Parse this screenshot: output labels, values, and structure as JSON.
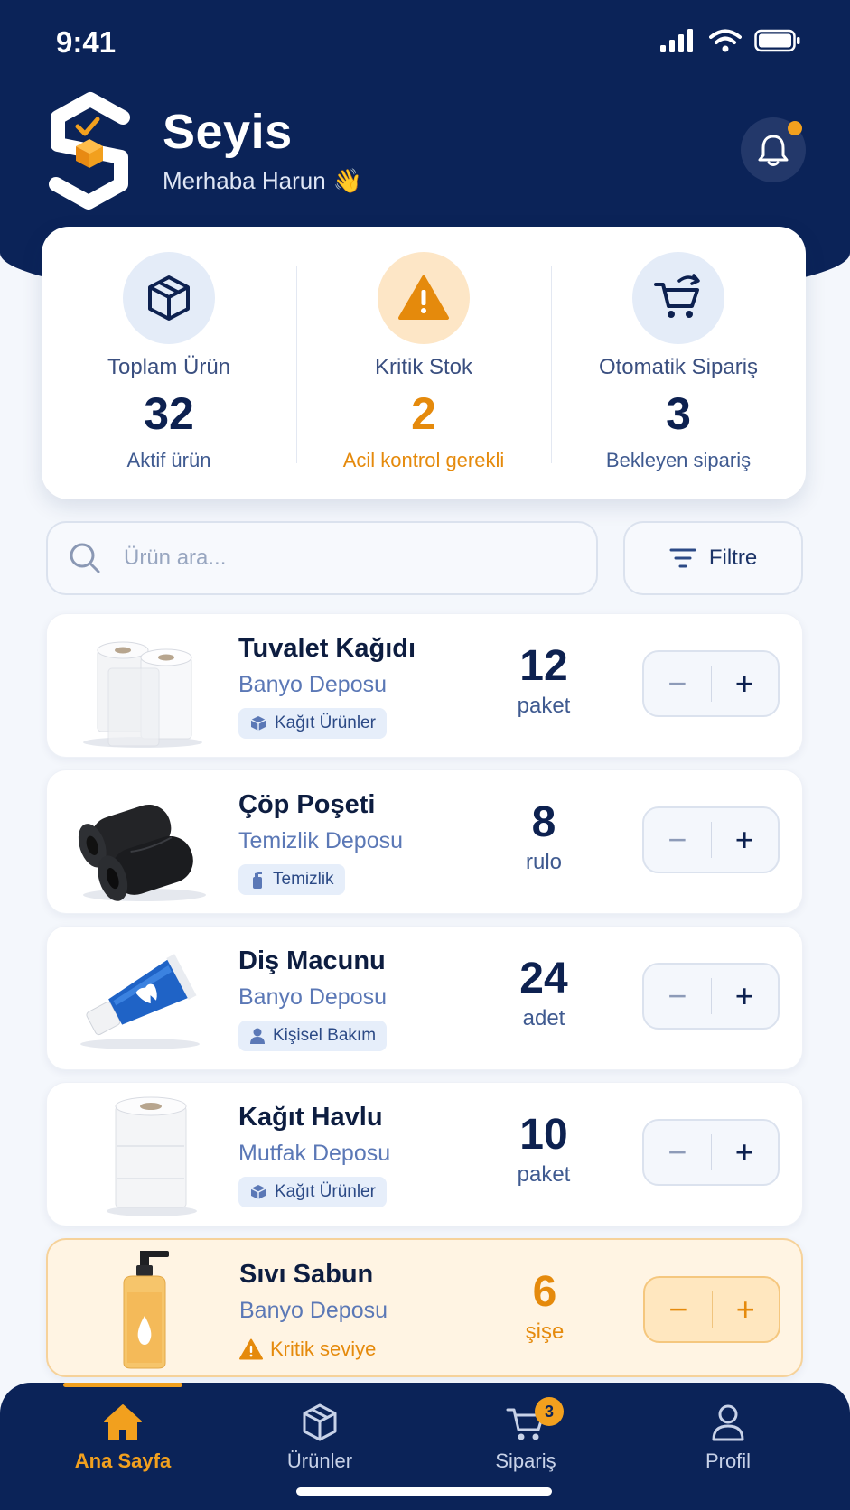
{
  "status_bar": {
    "time": "9:41"
  },
  "app": {
    "title": "Seyis",
    "greeting": "Merhaba Harun",
    "greeting_emoji": "👋"
  },
  "colors": {
    "navy": "#0b2358",
    "accent": "#f2a01e",
    "warning": "#e58a0c"
  },
  "notification": {
    "has_unread": true,
    "icon": "bell-icon"
  },
  "stats": [
    {
      "label": "Toplam Ürün",
      "value": "32",
      "sub": "Aktif ürün",
      "icon": "box-icon"
    },
    {
      "label": "Kritik Stok",
      "value": "2",
      "sub": "Acil kontrol gerekli",
      "icon": "warning-icon"
    },
    {
      "label": "Otomatik Sipariş",
      "value": "3",
      "sub": "Bekleyen sipariş",
      "icon": "cart-refresh-icon"
    }
  ],
  "search": {
    "placeholder": "Ürün ara...",
    "filter_label": "Filtre"
  },
  "products": [
    {
      "name": "Tuvalet Kağıdı",
      "location": "Banyo Deposu",
      "tag": "Kağıt Ürünler",
      "tag_icon": "box-icon",
      "qty": "12",
      "unit": "paket",
      "critical": false
    },
    {
      "name": "Çöp Poşeti",
      "location": "Temizlik Deposu",
      "tag": "Temizlik",
      "tag_icon": "spray-icon",
      "qty": "8",
      "unit": "rulo",
      "critical": false
    },
    {
      "name": "Diş Macunu",
      "location": "Banyo Deposu",
      "tag": "Kişisel Bakım",
      "tag_icon": "person-icon",
      "qty": "24",
      "unit": "adet",
      "critical": false
    },
    {
      "name": "Kağıt Havlu",
      "location": "Mutfak Deposu",
      "tag": "Kağıt Ürünler",
      "tag_icon": "box-icon",
      "qty": "10",
      "unit": "paket",
      "critical": false
    },
    {
      "name": "Sıvı Sabun",
      "location": "Banyo Deposu",
      "tag": "Kritik seviye",
      "tag_icon": "warning-icon",
      "qty": "6",
      "unit": "şişe",
      "critical": true
    }
  ],
  "stepper": {
    "minus": "−",
    "plus": "+"
  },
  "tabs": [
    {
      "label": "Ana Sayfa",
      "icon": "home-icon",
      "active": true
    },
    {
      "label": "Ürünler",
      "icon": "box-icon",
      "active": false
    },
    {
      "label": "Sipariş",
      "icon": "cart-icon",
      "active": false,
      "badge": "3"
    },
    {
      "label": "Profil",
      "icon": "user-icon",
      "active": false
    }
  ]
}
